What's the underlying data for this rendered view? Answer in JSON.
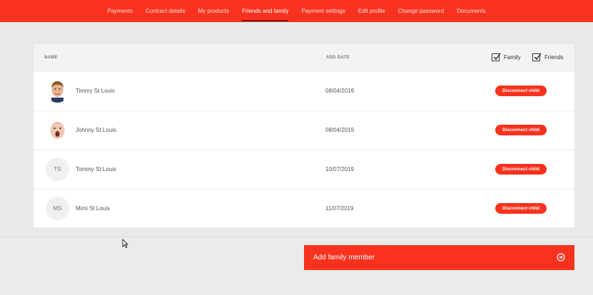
{
  "nav": {
    "items": [
      {
        "label": "Payments"
      },
      {
        "label": "Contract details"
      },
      {
        "label": "My products"
      },
      {
        "label": "Friends and family"
      },
      {
        "label": "Payment settings"
      },
      {
        "label": "Edit profile"
      },
      {
        "label": "Change password"
      },
      {
        "label": "Documents"
      }
    ],
    "active": "Friends and family"
  },
  "table": {
    "col_name": "NAME",
    "col_date": "ADD DATE",
    "filters": [
      {
        "label": "Family",
        "checked": true
      },
      {
        "label": "Friends",
        "checked": true
      }
    ],
    "rows": [
      {
        "name": "Timmy St Louis",
        "date": "08/04/2019",
        "avatar": "photo-boy",
        "initials": "",
        "action": "Disconnect child"
      },
      {
        "name": "Johnny St Louis",
        "date": "08/04/2019",
        "avatar": "photo-baby",
        "initials": "",
        "action": "Disconnect child"
      },
      {
        "name": "Tommy St Louis",
        "date": "10/07/2019",
        "avatar": "initials",
        "initials": "TS",
        "action": "Disconnect child"
      },
      {
        "name": "Mimi St Louis",
        "date": "11/07/2019",
        "avatar": "initials",
        "initials": "MS",
        "action": "Disconnect child"
      }
    ]
  },
  "add_button": {
    "label": "Add family member",
    "icon": "arrow-circle-right-icon"
  },
  "colors": {
    "accent": "#f8321e",
    "background": "#e9e9e9"
  }
}
